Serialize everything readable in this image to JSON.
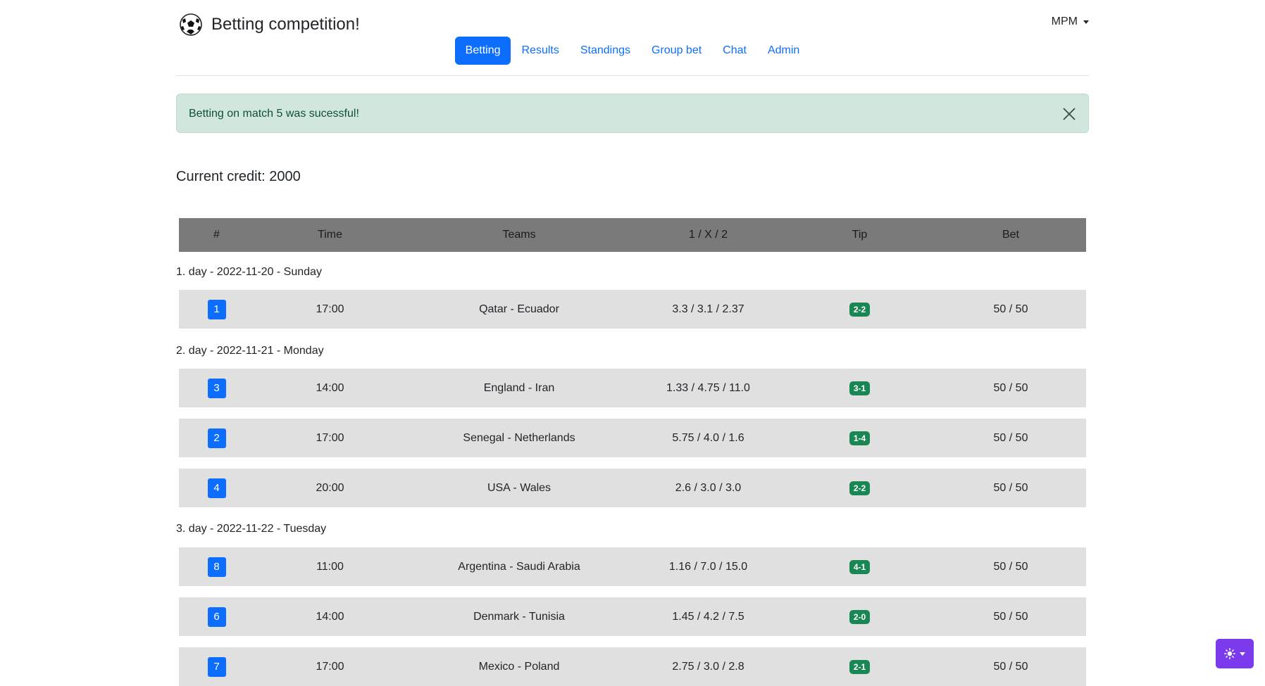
{
  "header": {
    "brand_title": "Betting competition!",
    "user_label": "MPM"
  },
  "nav": {
    "items": [
      {
        "label": "Betting",
        "active": true
      },
      {
        "label": "Results",
        "active": false
      },
      {
        "label": "Standings",
        "active": false
      },
      {
        "label": "Group bet",
        "active": false
      },
      {
        "label": "Chat",
        "active": false
      },
      {
        "label": "Admin",
        "active": false
      }
    ]
  },
  "alert": {
    "message": "Betting on match 5 was sucessful!"
  },
  "credit": {
    "text": "Current credit: 2000"
  },
  "table": {
    "headers": [
      "#",
      "Time",
      "Teams",
      "1 / X / 2",
      "Tip",
      "Bet"
    ],
    "days": [
      {
        "label": "1. day - 2022-11-20 - Sunday",
        "matches": [
          {
            "num": "1",
            "time": "17:00",
            "teams": "Qatar - Ecuador",
            "odds": "3.3 / 3.1 / 2.37",
            "tip": "2-2",
            "bet": "50 / 50"
          }
        ]
      },
      {
        "label": "2. day - 2022-11-21 - Monday",
        "matches": [
          {
            "num": "3",
            "time": "14:00",
            "teams": "England - Iran",
            "odds": "1.33 / 4.75 / 11.0",
            "tip": "3-1",
            "bet": "50 / 50"
          },
          {
            "num": "2",
            "time": "17:00",
            "teams": "Senegal - Netherlands",
            "odds": "5.75 / 4.0 / 1.6",
            "tip": "1-4",
            "bet": "50 / 50"
          },
          {
            "num": "4",
            "time": "20:00",
            "teams": "USA - Wales",
            "odds": "2.6 / 3.0 / 3.0",
            "tip": "2-2",
            "bet": "50 / 50"
          }
        ]
      },
      {
        "label": "3. day - 2022-11-22 - Tuesday",
        "matches": [
          {
            "num": "8",
            "time": "11:00",
            "teams": "Argentina - Saudi Arabia",
            "odds": "1.16 / 7.0 / 15.0",
            "tip": "4-1",
            "bet": "50 / 50"
          },
          {
            "num": "6",
            "time": "14:00",
            "teams": "Denmark - Tunisia",
            "odds": "1.45 / 4.2 / 7.5",
            "tip": "2-0",
            "bet": "50 / 50"
          },
          {
            "num": "7",
            "time": "17:00",
            "teams": "Mexico - Poland",
            "odds": "2.75 / 3.0 / 2.8",
            "tip": "2-1",
            "bet": "50 / 50"
          }
        ]
      }
    ]
  },
  "colors": {
    "primary": "#0d6efd",
    "success_badge": "#198754",
    "alert_bg": "#d1e7dd",
    "row_bg": "#e0e0e0",
    "header_bg": "#7a7a7a",
    "theme_button": "#7c3aed"
  },
  "icons": {
    "brand": "soccer-ball-icon",
    "alert_close": "close-icon",
    "theme": "sun-icon"
  }
}
